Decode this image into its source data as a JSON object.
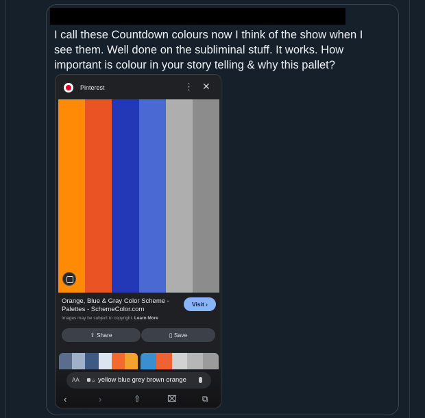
{
  "tweet": {
    "text": "I call these Countdown colours now I think of the show when I see them. Well done on the subliminal stuff. It works. How important is colour in your story telling & why this pallet?"
  },
  "embedded_screenshot": {
    "app_title": "Pinterest",
    "more_icon": "more-vertical-icon",
    "close_icon": "close-icon",
    "palette_colors": [
      "#ff8a05",
      "#ea5424",
      "#2238b6",
      "#4a69d3",
      "#aeaeae",
      "#8c8c8c"
    ],
    "result_title": "Orange, Blue & Gray Color Scheme - Palettes - SchemeColor.com",
    "visit_label": "Visit ›",
    "copyright_text": "Images may be subject to copyright.",
    "learn_more": "Learn More",
    "share_label": "Share",
    "save_label": "Save",
    "thumb1_colors": [
      "#5a6d8c",
      "#9fb1c9",
      "#3f5a82",
      "#dce4ef",
      "#f26a2d",
      "#f4a22e"
    ],
    "thumb2_colors": [
      "#3a8fd0",
      "#f26133",
      "#d2d2d2",
      "#b6b6b6",
      "#9b9b9b"
    ],
    "browser": {
      "aa_label": "AA",
      "url_text": "yellow blue grey brown orange"
    }
  }
}
